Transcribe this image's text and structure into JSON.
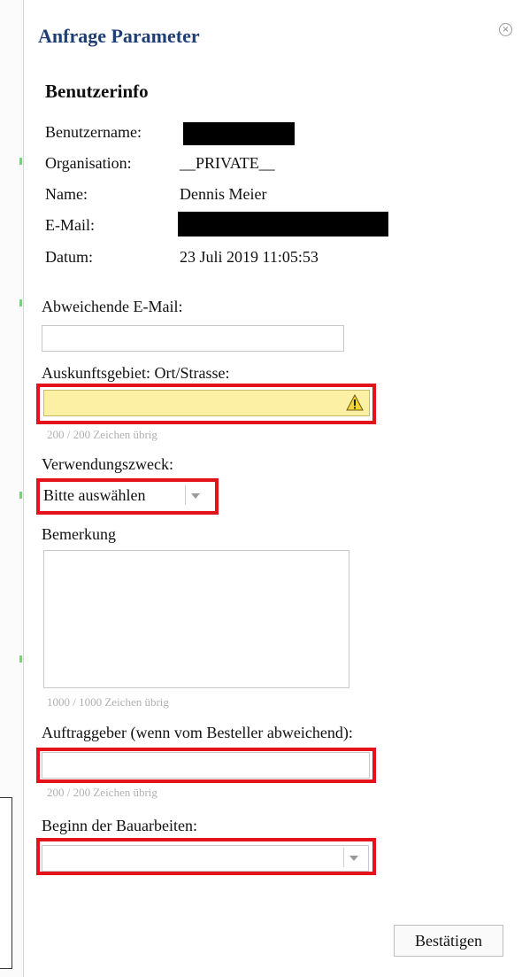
{
  "dialog": {
    "title": "Anfrage Parameter",
    "close_icon": "close-circle-icon"
  },
  "user_info": {
    "heading": "Benutzerinfo",
    "rows": [
      {
        "label": "Benutzername:",
        "value": ""
      },
      {
        "label": "Organisation:",
        "value": "__PRIVATE__"
      },
      {
        "label": "Name:",
        "value": "Dennis Meier"
      },
      {
        "label": "E-Mail:",
        "value": ""
      },
      {
        "label": "Datum:",
        "value": "23 Juli 2019 11:05:53"
      }
    ]
  },
  "form": {
    "alt_email": {
      "label": "Abweichende E-Mail:",
      "value": ""
    },
    "area": {
      "label": "Auskunftsgebiet: Ort/Strasse:",
      "value": "",
      "hint": "200 / 200 Zeichen übrig",
      "warning_icon": "warning-icon"
    },
    "purpose": {
      "label": "Verwendungszweck:",
      "selected": "Bitte auswählen"
    },
    "remark": {
      "label": "Bemerkung",
      "value": "",
      "hint": "1000 / 1000 Zeichen übrig"
    },
    "client": {
      "label": "Auftraggeber (wenn vom Besteller abweichend):",
      "value": "",
      "hint": "200 / 200 Zeichen übrig"
    },
    "construction_start": {
      "label": "Beginn der Bauarbeiten:",
      "selected": ""
    },
    "confirm_label": "Bestätigen"
  },
  "colors": {
    "title": "#1f3f74",
    "highlight": "#e3121b",
    "warning_bg": "#fbf0a4"
  }
}
